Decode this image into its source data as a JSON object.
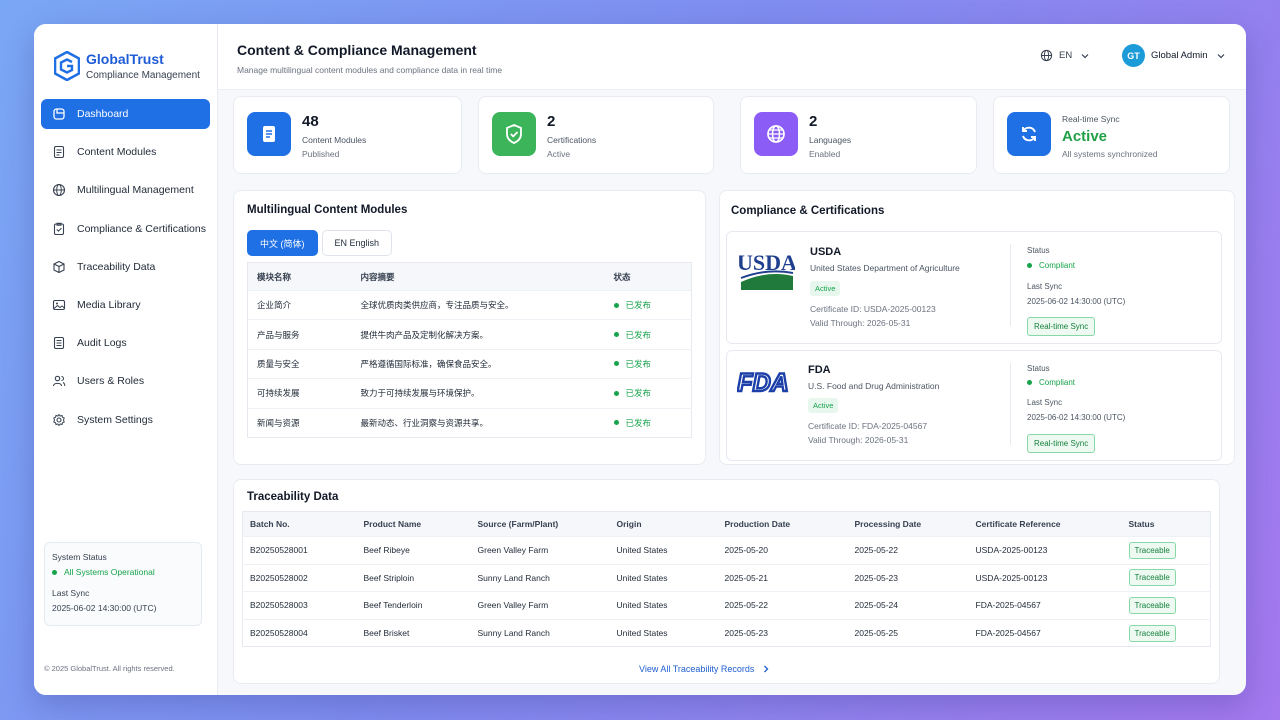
{
  "brand": {
    "name": "GlobalTrust",
    "subtitle": "Compliance Management"
  },
  "sidebar": {
    "items": [
      {
        "label": "Dashboard",
        "icon": "dashboard-icon",
        "active": true
      },
      {
        "label": "Content Modules",
        "icon": "document-icon"
      },
      {
        "label": "Multilingual Management",
        "icon": "globe-icon"
      },
      {
        "label": "Compliance & Certifications",
        "icon": "clipboard-check-icon"
      },
      {
        "label": "Traceability Data",
        "icon": "box-icon"
      },
      {
        "label": "Media Library",
        "icon": "image-icon"
      },
      {
        "label": "Audit Logs",
        "icon": "file-list-icon"
      },
      {
        "label": "Users & Roles",
        "icon": "users-icon"
      },
      {
        "label": "System Settings",
        "icon": "gear-icon"
      }
    ],
    "status": {
      "title": "System Status",
      "state": "All Systems Operational",
      "sync_label": "Last Sync",
      "sync_time": "2025-06-02 14:30:00 (UTC)"
    },
    "copyright": "© 2025 GlobalTrust. All rights reserved."
  },
  "header": {
    "title": "Content & Compliance Management",
    "subtitle": "Manage multilingual content modules and compliance data in real time",
    "language": "EN",
    "user_initials": "GT",
    "user_name": "Global Admin"
  },
  "stats": [
    {
      "value": "48",
      "line1": "Content Modules",
      "line2": "Published",
      "color": "#1f6fe5"
    },
    {
      "value": "2",
      "line1": "Certifications",
      "line2": "Active",
      "color": "#3cb55a"
    },
    {
      "value": "2",
      "line1": "Languages",
      "line2": "Enabled",
      "color": "#8b5cf6"
    },
    {
      "label": "Real-time Sync",
      "value": "Active",
      "line2": "All systems synchronized",
      "color": "#1f6fe5"
    }
  ],
  "modules": {
    "title": "Multilingual Content Modules",
    "tabs": [
      "中文 (简体)",
      "EN English"
    ],
    "columns": [
      "模块名称",
      "内容摘要",
      "状态"
    ],
    "rows": [
      {
        "name": "企业简介",
        "summary": "全球优质肉类供应商，专注品质与安全。",
        "status": "已发布"
      },
      {
        "name": "产品与服务",
        "summary": "提供牛肉产品及定制化解决方案。",
        "status": "已发布"
      },
      {
        "name": "质量与安全",
        "summary": "严格遵循国际标准，确保食品安全。",
        "status": "已发布"
      },
      {
        "name": "可持续发展",
        "summary": "致力于可持续发展与环境保护。",
        "status": "已发布"
      },
      {
        "name": "新闻与资源",
        "summary": "最新动态、行业洞察与资源共享。",
        "status": "已发布"
      }
    ]
  },
  "compliance": {
    "title": "Compliance & Certifications",
    "certs": [
      {
        "logo": "USDA",
        "name": "USDA",
        "full": "United States Department of Agriculture",
        "badge": "Active",
        "cert_id": "Certificate ID:  USDA-2025-00123",
        "valid": "Valid Through:  2026-05-31",
        "status_label": "Status",
        "status": "Compliant",
        "sync_label": "Last Sync",
        "sync_time": "2025-06-02 14:30:00 (UTC)",
        "sync_btn": "Real-time Sync"
      },
      {
        "logo": "FDA",
        "name": "FDA",
        "full": "U.S. Food and Drug Administration",
        "badge": "Active",
        "cert_id": "Certificate ID:  FDA-2025-04567",
        "valid": "Valid Through:  2026-05-31",
        "status_label": "Status",
        "status": "Compliant",
        "sync_label": "Last Sync",
        "sync_time": "2025-06-02 14:30:00 (UTC)",
        "sync_btn": "Real-time Sync"
      }
    ]
  },
  "trace": {
    "title": "Traceability Data",
    "columns": [
      "Batch No.",
      "Product Name",
      "Source (Farm/Plant)",
      "Origin",
      "Production Date",
      "Processing Date",
      "Certificate Reference",
      "Status"
    ],
    "rows": [
      [
        "B20250528001",
        "Beef Ribeye",
        "Green Valley Farm",
        "United States",
        "2025-05-20",
        "2025-05-22",
        "USDA-2025-00123",
        "Traceable"
      ],
      [
        "B20250528002",
        "Beef Striploin",
        "Sunny Land Ranch",
        "United States",
        "2025-05-21",
        "2025-05-23",
        "USDA-2025-00123",
        "Traceable"
      ],
      [
        "B20250528003",
        "Beef Tenderloin",
        "Green Valley Farm",
        "United States",
        "2025-05-22",
        "2025-05-24",
        "FDA-2025-04567",
        "Traceable"
      ],
      [
        "B20250528004",
        "Beef Brisket",
        "Sunny Land Ranch",
        "United States",
        "2025-05-23",
        "2025-05-25",
        "FDA-2025-04567",
        "Traceable"
      ]
    ],
    "view_all": "View All Traceability Records"
  }
}
